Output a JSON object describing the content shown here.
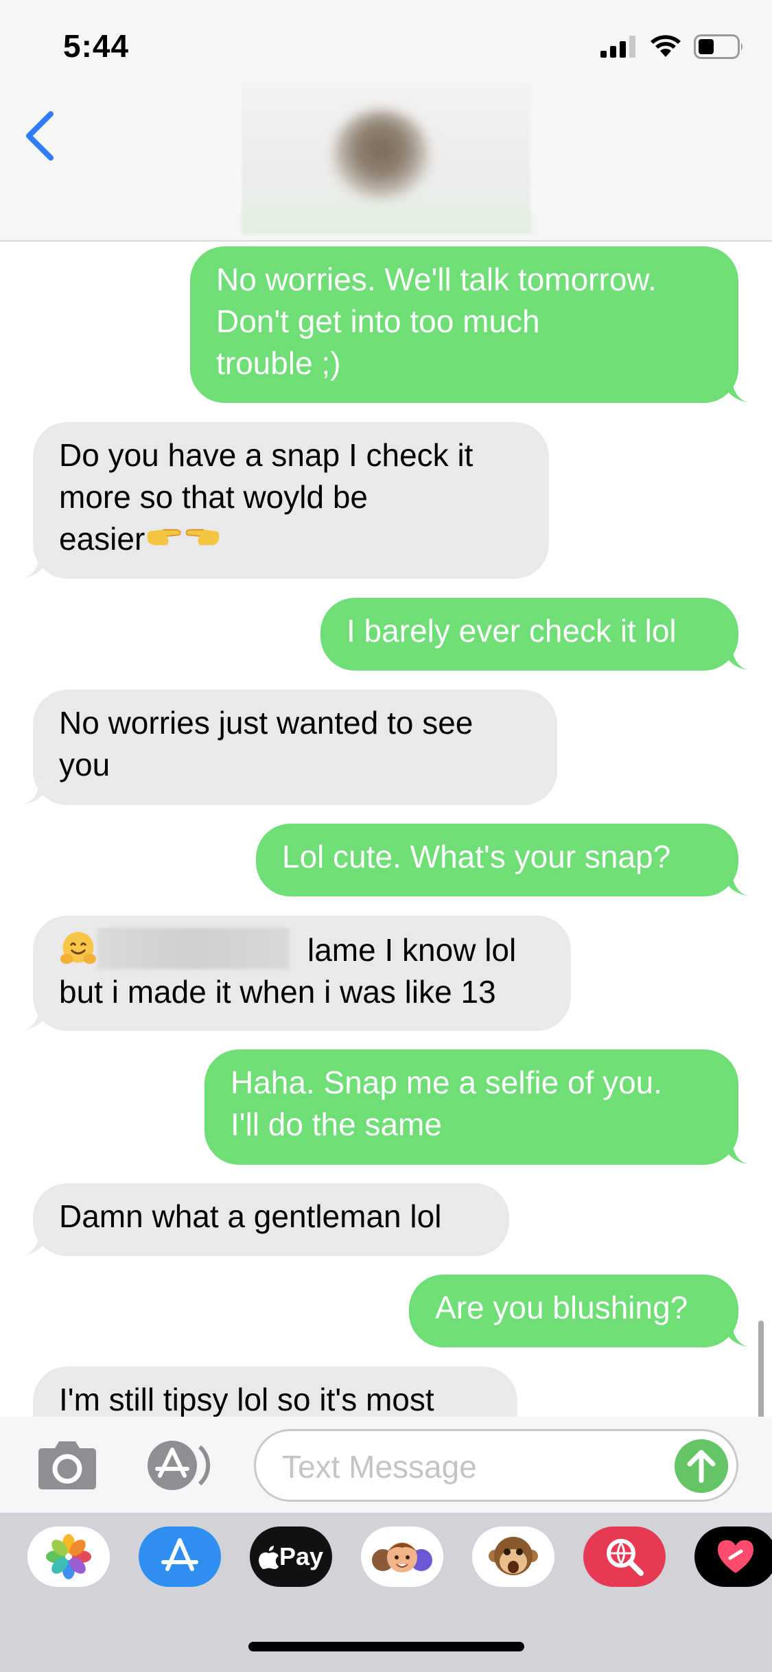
{
  "status_bar": {
    "time": "5:44",
    "icons": [
      "signal-icon",
      "wifi-icon",
      "battery-icon"
    ]
  },
  "header": {
    "back_icon": "chevron-left-icon",
    "contact_avatar": "blurred",
    "contact_name": "blurred"
  },
  "messages": [
    {
      "direction": "sent",
      "lines": [
        "No worries. We'll talk tomorrow.",
        "Don't get into too much",
        "trouble ;)"
      ]
    },
    {
      "direction": "received",
      "lines": [
        "Do you have a snap I check it",
        "more so  that woyld be",
        "easier"
      ],
      "emojis": [
        "point-right-emoji",
        "point-left-emoji"
      ]
    },
    {
      "direction": "sent",
      "lines": [
        "I barely ever check it lol"
      ]
    },
    {
      "direction": "received",
      "lines": [
        "No worries just wanted to see",
        "you"
      ]
    },
    {
      "direction": "sent",
      "lines": [
        "Lol cute. What's your snap?"
      ]
    },
    {
      "direction": "received",
      "lines": [
        "lame I know lol",
        "but i made it when i was like 13"
      ],
      "emojis": [
        "hugging-face-emoji"
      ],
      "redacted": true
    },
    {
      "direction": "sent",
      "lines": [
        "Haha. Snap me a selfie of you.",
        "I'll do the same"
      ]
    },
    {
      "direction": "received",
      "lines": [
        "Damn what a gentleman lol"
      ]
    },
    {
      "direction": "sent",
      "lines": [
        "Are you blushing?"
      ]
    },
    {
      "direction": "received",
      "lines": [
        "I'm still tipsy lol so it's most"
      ]
    }
  ],
  "input": {
    "placeholder": "Text Message",
    "camera_icon": "camera-icon",
    "apps_icon": "app-store-icon",
    "send_icon": "arrow-up-icon"
  },
  "app_drawer": {
    "apple_pay_label": "Pay",
    "apps": [
      "photos-icon",
      "app-store-icon",
      "apple-pay-icon",
      "memoji-icon",
      "animoji-icon",
      "image-search-icon",
      "digital-touch-icon"
    ]
  },
  "colors": {
    "sent_bubble": "#6fde76",
    "received_bubble": "#e9e9eb",
    "accent_blue": "#2f7cf6",
    "send_green": "#65c466"
  }
}
